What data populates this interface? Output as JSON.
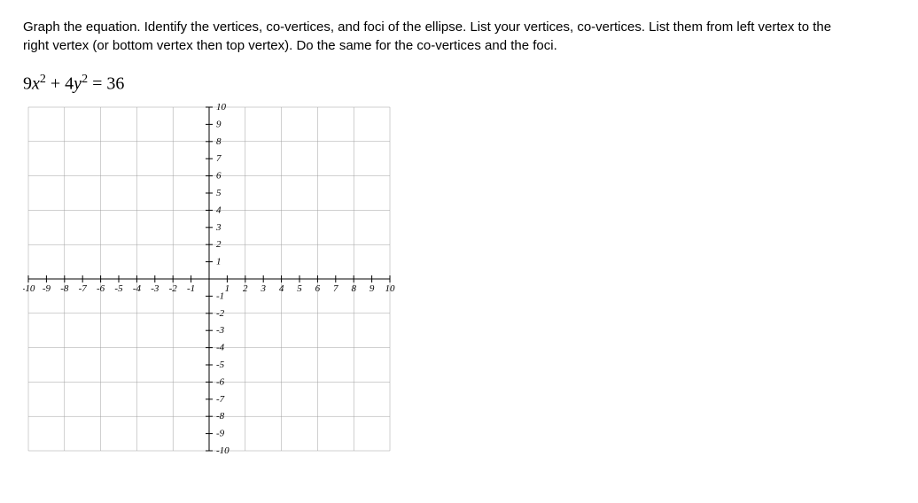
{
  "question": {
    "prompt": "Graph the equation. Identify the vertices, co-vertices, and foci of the ellipse. List your vertices, co-vertices. List them from left vertex to the right vertex (or bottom vertex then top vertex). Do the same for the co-vertices and the foci."
  },
  "equation": {
    "lhs_a": "9",
    "var1": "x",
    "exp1": "2",
    "plus": " + ",
    "lhs_b": "4",
    "var2": "y",
    "exp2": "2",
    "eq": " = ",
    "rhs": "36"
  },
  "chart_data": {
    "type": "scatter",
    "title": "",
    "xlabel": "",
    "ylabel": "",
    "xlim": [
      -10,
      10
    ],
    "ylim": [
      -10,
      10
    ],
    "xticks": [
      -10,
      -9,
      -8,
      -7,
      -6,
      -5,
      -4,
      -3,
      -2,
      -1,
      1,
      2,
      3,
      4,
      5,
      6,
      7,
      8,
      9,
      10
    ],
    "yticks": [
      -10,
      -9,
      -8,
      -7,
      -6,
      -5,
      -4,
      -3,
      -2,
      -1,
      1,
      2,
      3,
      4,
      5,
      6,
      7,
      8,
      9,
      10
    ],
    "series": []
  }
}
